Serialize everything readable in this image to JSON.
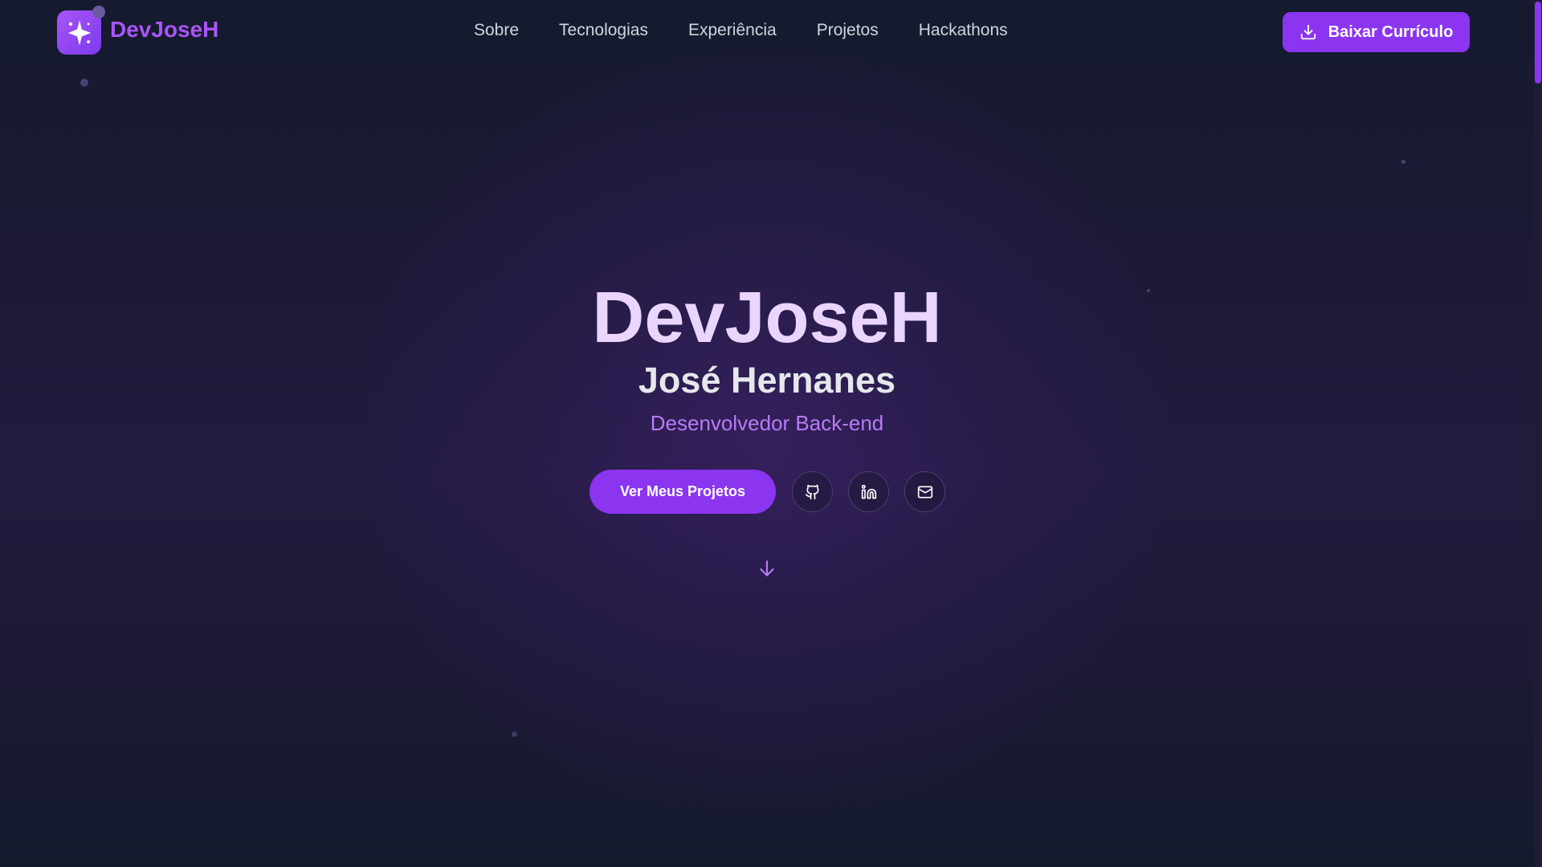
{
  "brand": {
    "name": "DevJoseH",
    "logo_icon": "sparkle-icon"
  },
  "nav": {
    "items": [
      {
        "label": "Sobre"
      },
      {
        "label": "Tecnologias"
      },
      {
        "label": "Experiência"
      },
      {
        "label": "Projetos"
      },
      {
        "label": "Hackathons"
      }
    ],
    "download_button": {
      "label": "Baixar Currículo",
      "icon": "download-icon"
    }
  },
  "hero": {
    "title": "DevJoseH",
    "name": "José Hernanes",
    "role": "Desenvolvedor Back-end",
    "cta_label": "Ver Meus Projetos",
    "social_icons": [
      "github-icon",
      "linkedin-icon",
      "mail-icon"
    ]
  },
  "colors": {
    "accent": "#8b35f0",
    "title": "#ead5ff",
    "role": "#b77cf5",
    "background": "#1c1a37"
  }
}
